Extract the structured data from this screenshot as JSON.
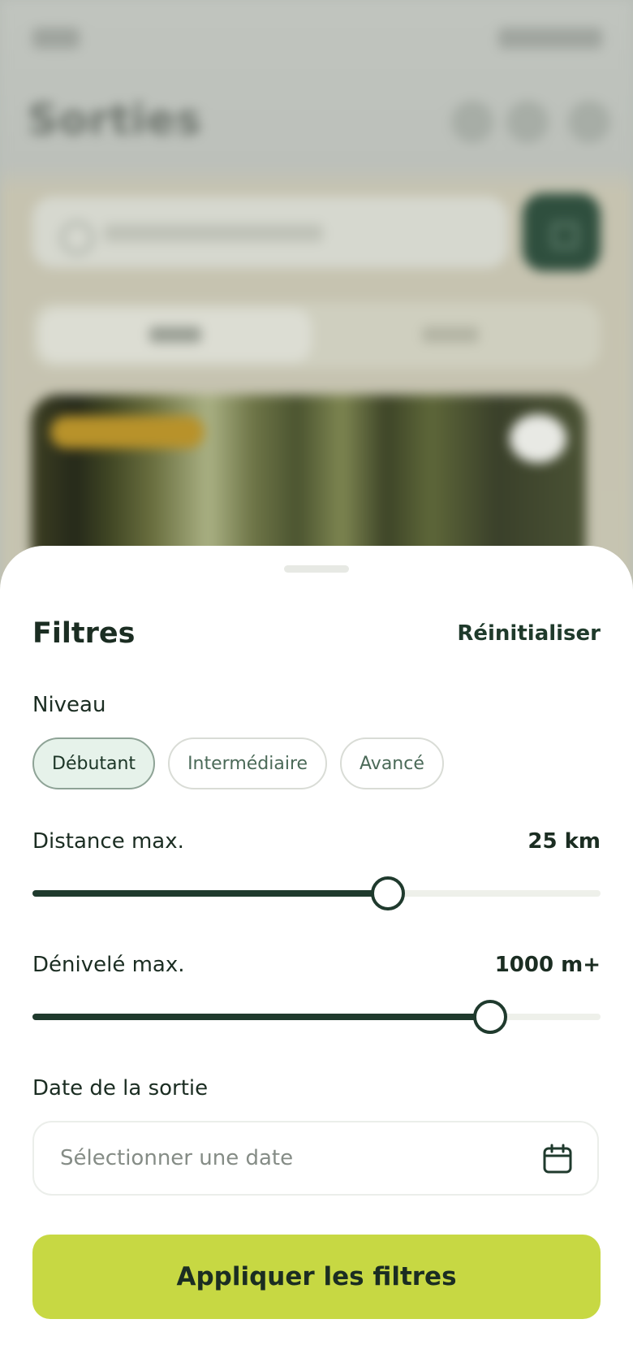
{
  "background": {
    "title": "Sorties"
  },
  "sheet": {
    "title": "Filtres",
    "reset_label": "Réinitialiser",
    "level": {
      "label": "Niveau",
      "options": [
        "Débutant",
        "Intermédiaire",
        "Avancé"
      ],
      "selected": "Débutant"
    },
    "distance": {
      "label": "Distance max.",
      "value": "25 km",
      "fraction": 0.62
    },
    "elevation": {
      "label": "Dénivelé max.",
      "value": "1000 m+",
      "fraction": 0.8
    },
    "date": {
      "label": "Date de la sortie",
      "placeholder": "Sélectionner une date",
      "icon": "calendar-icon"
    },
    "apply_label": "Appliquer les filtres"
  },
  "colors": {
    "primary_dark": "#1f3a2d",
    "accent_lime": "#c7d843",
    "chip_active_bg": "#e6f2ea"
  }
}
